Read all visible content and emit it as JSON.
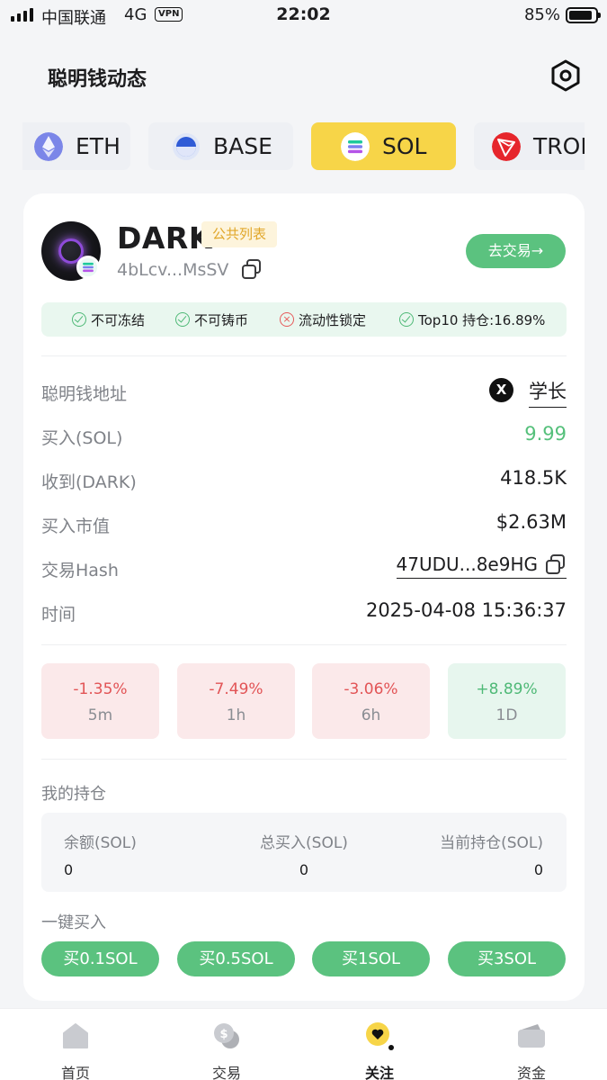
{
  "status_bar": {
    "carrier": "中国联通",
    "network": "4G",
    "vpn": "VPN",
    "time": "22:02",
    "battery": "85%"
  },
  "header": {
    "title": "聪明钱动态"
  },
  "chain_tabs": [
    {
      "label": "ETH",
      "active": false
    },
    {
      "label": "BASE",
      "active": false
    },
    {
      "label": "SOL",
      "active": true
    },
    {
      "label": "TRON",
      "active": false
    }
  ],
  "token": {
    "name": "DARK",
    "tag": "公共列表",
    "address": "4bLcv...MsSV",
    "trade_button": "去交易→"
  },
  "safety": {
    "no_freeze": "不可冻结",
    "no_mint": "不可铸币",
    "liquidity_locked": "流动性锁定",
    "top10": "Top10 持仓:16.89%"
  },
  "details": {
    "wallet": {
      "label": "聪明钱地址",
      "value": "学长",
      "badge": "X"
    },
    "buy": {
      "label": "买入(SOL)",
      "value": "9.99"
    },
    "received": {
      "label": "收到(DARK)",
      "value": "418.5K"
    },
    "market_cap": {
      "label": "买入市值",
      "value": "$2.63M"
    },
    "hash": {
      "label": "交易Hash",
      "value": "47UDU...8e9HG"
    },
    "time": {
      "label": "时间",
      "value": "2025-04-08 15:36:37"
    }
  },
  "changes": [
    {
      "pct": "-1.35%",
      "period": "5m",
      "dir": "neg"
    },
    {
      "pct": "-7.49%",
      "period": "1h",
      "dir": "neg"
    },
    {
      "pct": "-3.06%",
      "period": "6h",
      "dir": "neg"
    },
    {
      "pct": "+8.89%",
      "period": "1D",
      "dir": "pos"
    }
  ],
  "holdings": {
    "title": "我的持仓",
    "balance_label": "余额(SOL)",
    "balance_value": "0",
    "total_buy_label": "总买入(SOL)",
    "total_buy_value": "0",
    "current_label": "当前持仓(SOL)",
    "current_value": "0"
  },
  "quick_buy": {
    "title": "一键买入",
    "buttons": [
      "买0.1SOL",
      "买0.5SOL",
      "买1SOL",
      "买3SOL"
    ]
  },
  "bottom_nav": [
    {
      "label": "首页",
      "active": false
    },
    {
      "label": "交易",
      "active": false
    },
    {
      "label": "关注",
      "active": true
    },
    {
      "label": "资金",
      "active": false
    }
  ],
  "colors": {
    "accent_yellow": "#f7d548",
    "positive_green": "#55c07b",
    "negative_red": "#e25456",
    "button_green": "#5bc27f"
  }
}
